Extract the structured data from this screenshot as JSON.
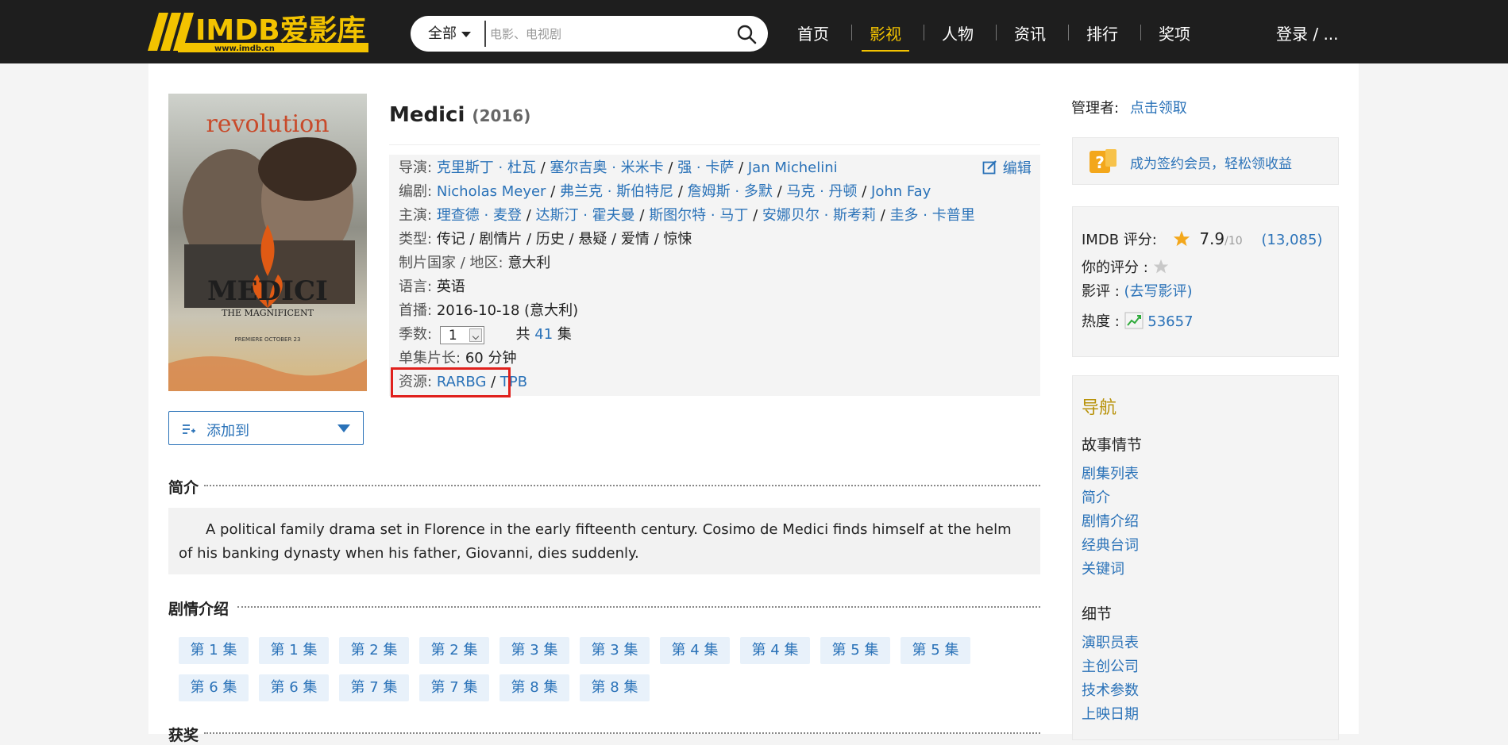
{
  "header": {
    "logo_text": "IMDB爱影库",
    "logo_url_text": "www.imdb.cn",
    "search": {
      "category": "全部",
      "placeholder": "电影、电视剧"
    },
    "nav": [
      "首页",
      "影视",
      "人物",
      "资讯",
      "排行",
      "奖项"
    ],
    "nav_active": "影视",
    "login": "登录 / ..."
  },
  "movie": {
    "title": "Medici",
    "year": "(2016)",
    "edit_label": "编辑",
    "add_to_label": "添加到",
    "poster": {
      "title_top": "revolution",
      "title_main": "MEDICI",
      "title_sub": "THE MAGNIFICENT",
      "premiere": "PREMIERE   OCTOBER 23"
    },
    "director_label": "导演:",
    "directors": [
      "克里斯丁 · 杜瓦",
      "塞尔吉奥 · 米米卡",
      "强 · 卡萨",
      "Jan Michelini"
    ],
    "writer_label": "编剧:",
    "writers": [
      "Nicholas Meyer",
      "弗兰克 · 斯伯特尼",
      "詹姆斯 · 多默",
      "马克 · 丹顿",
      "John Fay"
    ],
    "cast_label": "主演:",
    "cast": [
      "理查德 · 麦登",
      "达斯汀 · 霍夫曼",
      "斯图尔特 · 马丁",
      "安娜贝尔 · 斯考莉",
      "圭多 · 卡普里"
    ],
    "genre_label": "类型:",
    "genres": "传记 / 剧情片 / 历史 / 悬疑 / 爱情 / 惊悚",
    "country_label": "制片国家 / 地区:",
    "country": "意大利",
    "language_label": "语言:",
    "language": "英语",
    "premiere_label": "首播:",
    "premiere": "2016-10-18 (意大利)",
    "season_label": "季数:",
    "season_value": "1",
    "episodes_prefix": "共",
    "episodes_count": "41",
    "episodes_suffix": "集",
    "runtime_label": "单集片长:",
    "runtime": "60 分钟",
    "resources_label": "资源:",
    "resources": [
      "RARBG",
      "TPB"
    ]
  },
  "synopsis": {
    "heading": "简介",
    "text": "A political family drama set in Florence in the early fifteenth century. Cosimo de Medici finds himself at the helm of his banking dynasty when his father, Giovanni, dies suddenly."
  },
  "plot": {
    "heading": "剧情介绍",
    "episodes": [
      "第 1 集",
      "第 1 集",
      "第 2 集",
      "第 2 集",
      "第 3 集",
      "第 3 集",
      "第 4 集",
      "第 4 集",
      "第 5 集",
      "第 5 集",
      "第 6 集",
      "第 6 集",
      "第 7 集",
      "第 7 集",
      "第 8 集",
      "第 8 集"
    ]
  },
  "next_heading": "获奖",
  "sidebar": {
    "manager_label": "管理者:",
    "manager_link": "点击领取",
    "vip_text": "成为签约会员，轻松领收益",
    "rating_label": "IMDB 评分:",
    "rating": "7.9",
    "rating_max": "/10",
    "rating_votes": "(13,085)",
    "your_rating_label": "你的评分 :",
    "review_label": "影评 :",
    "review_link": "(去写影评)",
    "heat_label": "热度 :",
    "heat_value": "53657",
    "nav_title": "导航",
    "groups": [
      {
        "title": "故事情节",
        "links": [
          "剧集列表",
          "简介",
          "剧情介绍",
          "经典台词",
          "关键词"
        ]
      },
      {
        "title": "细节",
        "links": [
          "演职员表",
          "主创公司",
          "技术参数",
          "上映日期"
        ]
      }
    ]
  },
  "colors": {
    "header_bg": "#1e1e1e",
    "accent_yellow": "#f3c300",
    "link_blue": "#2a72b8",
    "highlight_red": "#e0201c"
  }
}
